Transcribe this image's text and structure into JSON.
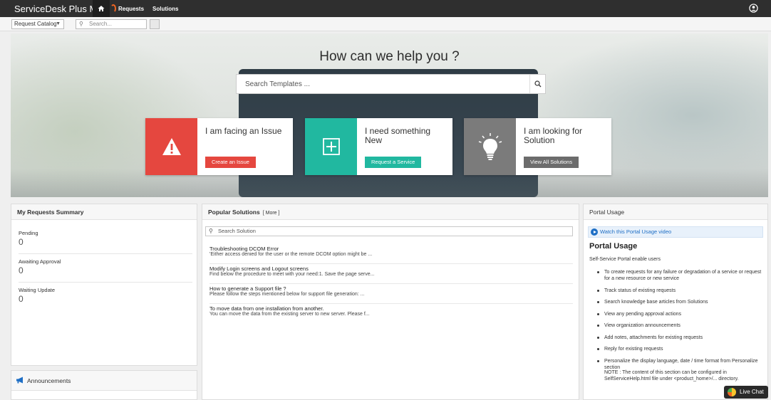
{
  "topbar": {
    "brand": "ServiceDesk Plus MSP",
    "nav": [
      "Requests",
      "Solutions"
    ]
  },
  "subbar": {
    "catalog_label": "Request Catalog",
    "search_placeholder": "Search..."
  },
  "hero": {
    "title": "How can we help you ?",
    "search_placeholder": "Search Templates ..."
  },
  "cards": [
    {
      "title": "I am facing an Issue",
      "button": "Create an Issue",
      "icon": "warning-icon",
      "color": "#e5473f"
    },
    {
      "title": "I need something New",
      "button": "Request a Service",
      "icon": "plus-icon",
      "color": "#21b8a0"
    },
    {
      "title": "I am looking for Solution",
      "button": "View All Solutions",
      "icon": "lightbulb-icon",
      "color": "#6c6c6c"
    }
  ],
  "summary": {
    "title": "My Requests Summary",
    "items": [
      {
        "label": "Pending",
        "value": "0"
      },
      {
        "label": "Awaiting Approval",
        "value": "0"
      },
      {
        "label": "Waiting Update",
        "value": "0"
      }
    ]
  },
  "announcements": {
    "title": "Announcements"
  },
  "popular": {
    "title": "Popular Solutions",
    "more": "[ More ]",
    "search_placeholder": "Search Solution",
    "items": [
      {
        "title": "Troubleshooting DCOM Error",
        "desc": "'Either access denied for the user or the remote DCOM option might be ..."
      },
      {
        "title": "Modify Login screens and Logout screens",
        "desc": "Find below the procedure to meet with your need:1. Save the page serve..."
      },
      {
        "title": "How to generate a Support file ?",
        "desc": "Please follow the steps mentioned below for support file generation: ..."
      },
      {
        "title": "To move data from one installation from another.",
        "desc": "You can move the data from the existing server to new server. Please f..."
      }
    ]
  },
  "usage": {
    "title": "Portal Usage",
    "video_link": "Watch this Portal Usage video",
    "heading": "Portal Usage",
    "intro": "Self-Service Portal enable users",
    "bullets": [
      "To create requests for any failure or degradation of a service or request for a new resource or new service",
      "Track status of existing requests",
      "Search knowledge base articles from Solutions",
      "View any pending approval actions",
      "View organization announcements",
      "Add notes, attachments for existing requests",
      "Reply for existing requests",
      "Personalize the display language, date / time format from Personalize section"
    ],
    "note": "NOTE : The content of this section can be configured in SelfServiceHelp.html file under <product_home>/... directory."
  },
  "livechat": {
    "label": "Live Chat"
  }
}
